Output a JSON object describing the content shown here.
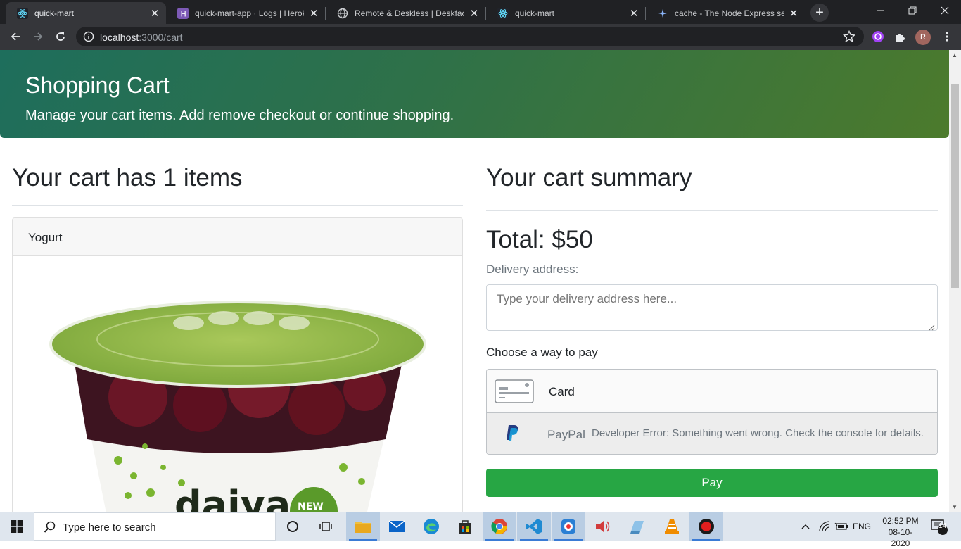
{
  "browser": {
    "tabs": [
      {
        "title": "quick-mart",
        "icon": "react-icon",
        "active": true
      },
      {
        "title": "quick-mart-app · Logs | Heroku",
        "icon": "heroku-icon",
        "active": false
      },
      {
        "title": "Remote & Deskless | Deskfactor",
        "icon": "globe-icon",
        "active": false
      },
      {
        "title": "quick-mart",
        "icon": "react-icon",
        "active": false
      },
      {
        "title": "cache - The Node Express server",
        "icon": "sparkle-icon",
        "active": false
      }
    ],
    "url_host": "localhost",
    "url_path": ":3000/cart",
    "profile_initial": "R"
  },
  "hero": {
    "title": "Shopping Cart",
    "subtitle": "Manage your cart items. Add remove checkout or continue shopping."
  },
  "cart": {
    "heading": "Your cart has 1 items",
    "items": [
      {
        "name": "Yogurt",
        "brand": "daiya",
        "badge": "NEW"
      }
    ]
  },
  "summary": {
    "heading": "Your cart summary",
    "total": "Total: $50",
    "address_label": "Delivery address:",
    "address_placeholder": "Type your delivery address here...",
    "pay_label": "Choose a way to pay",
    "options": {
      "card": "Card",
      "paypal": "PayPal",
      "paypal_error": "Developer Error: Something went wrong. Check the console for details."
    },
    "pay_button": "Pay"
  },
  "taskbar": {
    "search_placeholder": "Type here to search",
    "language": "ENG",
    "time": "02:52 PM",
    "date": "08-10-2020",
    "notifications": "14"
  },
  "colors": {
    "hero_start": "#1e6e5c",
    "hero_end": "#4c7a2c",
    "pay_button": "#27a644",
    "browser_dark": "#202124"
  }
}
